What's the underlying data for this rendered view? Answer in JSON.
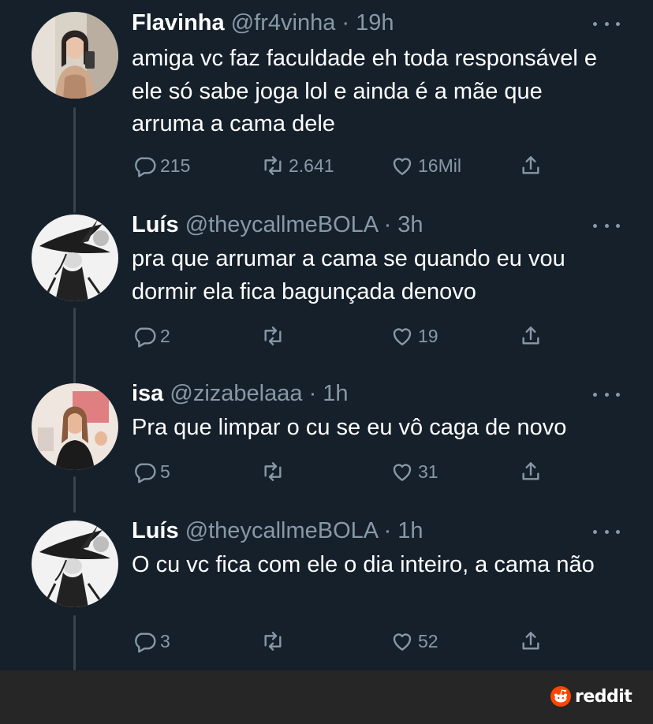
{
  "tweets": [
    {
      "name": "Flavinha",
      "handle": "@fr4vinha",
      "time": "· 19h",
      "text": "amiga vc faz faculdade eh toda responsável e ele só sabe joga lol e ainda é a mãe que arruma a cama dele",
      "replies": "215",
      "retweets": "2.641",
      "likes": "16Mil",
      "avatar": "woman-mirror-selfie"
    },
    {
      "name": "Luís",
      "handle": "@theycallmeBOLA",
      "time": "· 3h",
      "text": "pra que arrumar a cama se quando eu vou dormir ela fica bagunçada denovo",
      "replies": "2",
      "retweets": "",
      "likes": "19",
      "avatar": "witch-drawing"
    },
    {
      "name": "isa",
      "handle": "@zizabelaaa",
      "time": "· 1h",
      "text": "Pra que limpar o cu se eu vô caga de novo",
      "replies": "5",
      "retweets": "",
      "likes": "31",
      "avatar": "woman-photo"
    },
    {
      "name": "Luís",
      "handle": "@theycallmeBOLA",
      "time": "· 1h",
      "text": "O cu vc fica com ele o dia inteiro, a cama não",
      "replies": "3",
      "retweets": "",
      "likes": "52",
      "avatar": "witch-drawing"
    }
  ],
  "footer": {
    "brand": "reddit"
  },
  "colors": {
    "background": "#15202b",
    "text": "#ffffff",
    "muted": "#8899a6",
    "thread_line": "#38444d",
    "footer_bg": "#262626",
    "reddit_orange": "#ff4500"
  },
  "icons": [
    "reply-icon",
    "retweet-icon",
    "like-icon",
    "share-icon",
    "more-icon",
    "reddit-logo-icon"
  ]
}
